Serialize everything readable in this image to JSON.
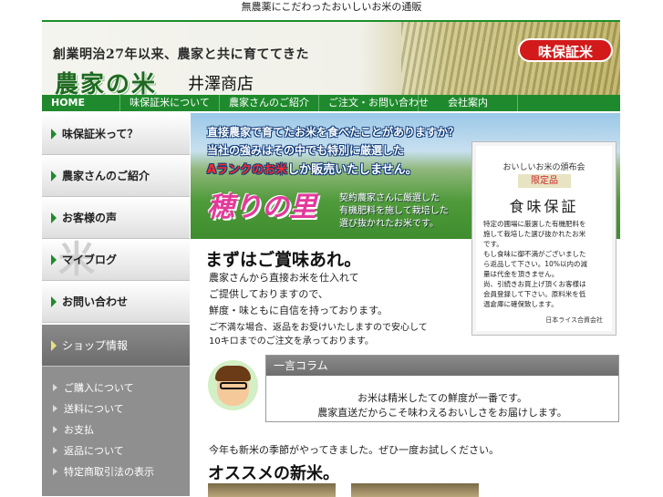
{
  "topline": "無農薬にこだわったおいしいお米の通販",
  "header": {
    "slogan": "創業明治27年以来、農家と共に育ててきた",
    "brand": "農家の米",
    "shop": "井澤商店",
    "badge": "味保証米"
  },
  "nav": [
    "HOME",
    "味保証米について",
    "農家さんのご紹介",
    "ご注文・お問い合わせ",
    "会社案内"
  ],
  "sidebar": {
    "items": [
      "味保証米って？",
      "農家さんのご紹介",
      "お客様の声",
      "マイブログ",
      "お問い合わせ",
      "ショップ情報"
    ],
    "watermark": "米",
    "submenu": [
      "ご購入について",
      "送料について",
      "お支払",
      "返品について",
      "特定商取引法の表示"
    ]
  },
  "hero": {
    "line1": "直接農家で育てたお米を食べたことがありますか？",
    "line2": "当社の強みはその中でも特別に厳選した",
    "line3_red": "Aランクのお米",
    "line3_rest": "しか販売いたしません。",
    "logo": "穂りの里",
    "desc": [
      "契約農家さんに厳選した",
      "有機肥料を施して栽培した",
      "選び抜かれたお米です。"
    ]
  },
  "cert": {
    "head": "おいしいお米の頒布会",
    "limit": "限定品",
    "title": "食味保証",
    "body": [
      "特定の圃場に厳選した有機肥料を",
      "施して栽培した選び抜かれたお米",
      "です。",
      "もし食味に御不満がございました",
      "ら返品して下さい。10%以内の減",
      "量は代金を頂きません。",
      "尚、引続きお買上げ頂くお客様は",
      "会員登録して下さい。原料米を低",
      "温倉庫に確保致します。"
    ],
    "foot": "日本ライス合資会社"
  },
  "main": {
    "title": "まずはご賞味あれ。",
    "paragraphs": [
      "農家さんから直接お米を仕入れて",
      "ご提供しておりますので、",
      "鮮度・味ともに自信を持っております。",
      "ご不満な場合、返品をお受けいたしますので安心して",
      "10キロまでのご注文を承っております。"
    ]
  },
  "column": {
    "heading": "一言コラム",
    "lines": [
      "お米は精米したての鮮度が一番です。",
      "農家直送だからこそ味わえるおいしさをお届けします。"
    ]
  },
  "note": "今年も新米の季節がやってきました。ぜひ一度お試しください。",
  "recommend_title": "オススメの新米。"
}
